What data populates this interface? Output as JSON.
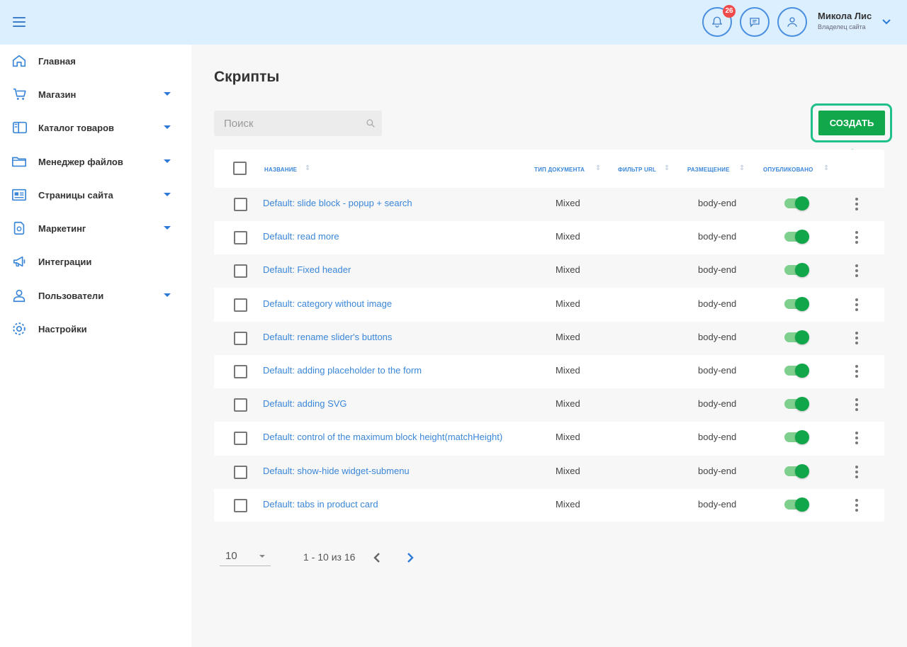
{
  "header": {
    "notifications_count": "26",
    "user_name": "Микола Лис",
    "user_role": "Владелец сайта"
  },
  "sidebar": {
    "items": [
      {
        "label": "Главная",
        "icon": "home-icon",
        "has_submenu": false
      },
      {
        "label": "Магазин",
        "icon": "cart-icon",
        "has_submenu": true
      },
      {
        "label": "Каталог товаров",
        "icon": "catalog-icon",
        "has_submenu": true
      },
      {
        "label": "Менеджер файлов",
        "icon": "folder-icon",
        "has_submenu": true
      },
      {
        "label": "Страницы сайта",
        "icon": "pages-icon",
        "has_submenu": true
      },
      {
        "label": "Маркетинг",
        "icon": "marketing-icon",
        "has_submenu": true
      },
      {
        "label": "Интеграции",
        "icon": "megaphone-icon",
        "has_submenu": false
      },
      {
        "label": "Пользователи",
        "icon": "users-icon",
        "has_submenu": true
      },
      {
        "label": "Настройки",
        "icon": "gear-icon",
        "has_submenu": false
      }
    ]
  },
  "main": {
    "title": "Скрипты",
    "search_placeholder": "Поиск",
    "create_label": "СОЗДАТЬ"
  },
  "table": {
    "columns": [
      "Название",
      "Тип документа",
      "Фильтр URL",
      "Размещение",
      "Опубликовано"
    ],
    "rows": [
      {
        "name": "Default: slide block - popup + search",
        "type": "Mixed",
        "placement": "body-end",
        "published": true
      },
      {
        "name": "Default: read more",
        "type": "Mixed",
        "placement": "body-end",
        "published": true
      },
      {
        "name": "Default: Fixed header",
        "type": "Mixed",
        "placement": "body-end",
        "published": true
      },
      {
        "name": "Default: category without image",
        "type": "Mixed",
        "placement": "body-end",
        "published": true
      },
      {
        "name": "Default: rename slider's buttons",
        "type": "Mixed",
        "placement": "body-end",
        "published": true
      },
      {
        "name": "Default: adding placeholder to the form",
        "type": "Mixed",
        "placement": "body-end",
        "published": true
      },
      {
        "name": "Default: adding SVG",
        "type": "Mixed",
        "placement": "body-end",
        "published": true
      },
      {
        "name": "Default: control of the maximum block height(matchHeight)",
        "type": "Mixed",
        "placement": "body-end",
        "published": true
      },
      {
        "name": "Default: show-hide widget-submenu",
        "type": "Mixed",
        "placement": "body-end",
        "published": true
      },
      {
        "name": "Default: tabs in product card",
        "type": "Mixed",
        "placement": "body-end",
        "published": true
      }
    ]
  },
  "pagination": {
    "per_page": "10",
    "range": "1 - 10 из 16"
  },
  "colors": {
    "accent": "#3a86d8",
    "header_bg": "#dcefff",
    "create_button": "#11a84c",
    "highlight_outline": "#1fc08a",
    "toggle_on": "#12a64a",
    "badge": "#f04a4a"
  }
}
